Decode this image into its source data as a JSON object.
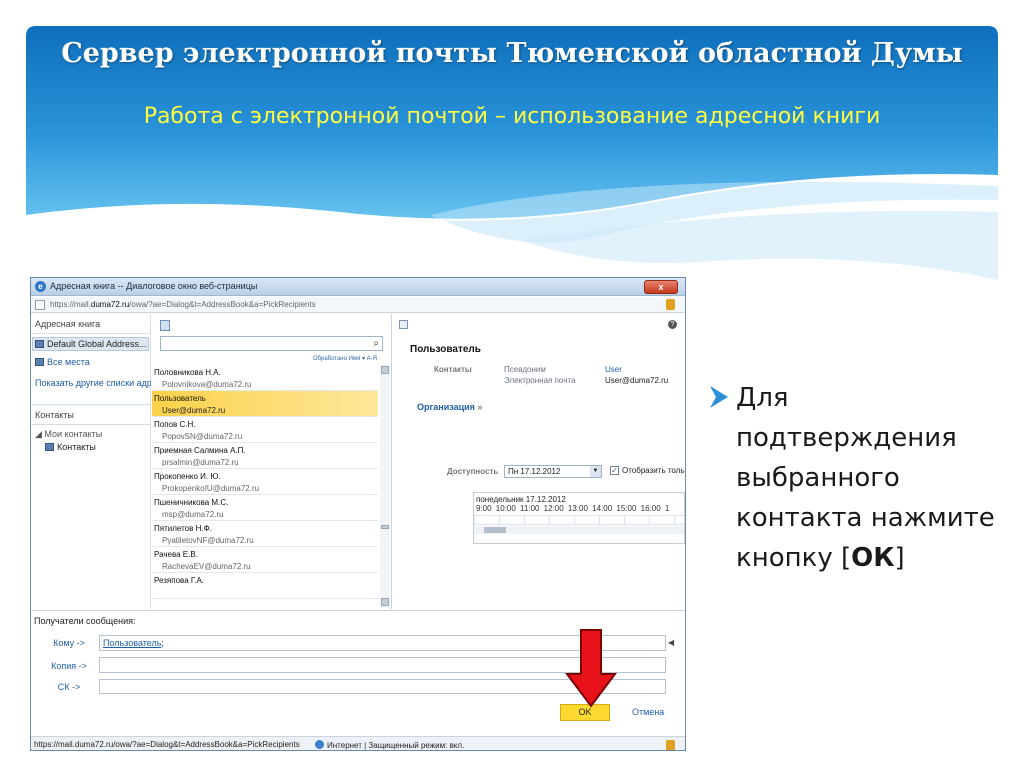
{
  "slide": {
    "title": "Сервер электронной почты Тюменской областной Думы",
    "subtitle": "Работа с электронной почтой – использование адресной книги",
    "bullet_before": "Для подтверждения выбранного контакта нажмите кнопку [",
    "bullet_bold": "ОК",
    "bullet_after": "]"
  },
  "window": {
    "title": "Адресная книга -- Диалоговое окно веб-страницы",
    "close_label": "x",
    "url_host": "https://mail.",
    "url_domain": "duma72.ru",
    "url_path": "/owa/?ae=Dialog&t=AddressBook&a=PickRecipients"
  },
  "leftnav": {
    "address_book_header": "Адресная книга",
    "selected_book": "Default Global Address...",
    "all_places": "Все места",
    "show_other_lists": "Показать другие списки адре",
    "contacts_header": "Контакты",
    "my_contacts": "Мои контакты",
    "contacts_folder": "Контакты"
  },
  "list": {
    "sort_label": "Обработано Имя ▾   А-Я",
    "entries": [
      {
        "name": "Половникова Н.А.",
        "email": "Polovnikova@duma72.ru"
      },
      {
        "name": "Пользователь",
        "email": "User@duma72.ru"
      },
      {
        "name": "Попов С.Н.",
        "email": "PopovSN@duma72.ru"
      },
      {
        "name": "Приемная Салмина А.П.",
        "email": "prsalmin@duma72.ru"
      },
      {
        "name": "Прокопенко И. Ю.",
        "email": "ProkopenkoIU@duma72.ru"
      },
      {
        "name": "Пшеничникова М.С.",
        "email": "msp@duma72.ru"
      },
      {
        "name": "Пятилетов Н.Ф.",
        "email": "PyatiletovNF@duma72.ru"
      },
      {
        "name": "Рачева Е.В.",
        "email": "RachevaEV@duma72.ru"
      },
      {
        "name": "Резяпова Г.А.",
        "email": ""
      }
    ],
    "selected_index": 1
  },
  "detail": {
    "title": "Пользователь",
    "contacts_label": "Контакты",
    "alias_label": "Псевдоним",
    "alias_value": "User",
    "email_label": "Электронная почта",
    "email_value": "User@duma72.ru",
    "organization_label": "Организация",
    "organization_chevron": "»",
    "availability_label": "Доступность",
    "date_value": "Пн 17.12.2012",
    "show_only_label": "Отобразить только ра",
    "schedule_day": "понедельник 17.12.2012",
    "schedule_hours": "9:00 10:00 11:00 12:00 13:00 14:00 15:00 16:00 1"
  },
  "recipients": {
    "header": "Получатели сообщения:",
    "to_label": "Кому ->",
    "to_value": "Пользователь",
    "to_separator": ";",
    "cc_label": "Копия ->",
    "bcc_label": "СК ->"
  },
  "buttons": {
    "ok": "OK",
    "cancel": "Отмена"
  },
  "status": {
    "url": "https://mail.duma72.ru/owa/?ae=Dialog&t=AddressBook&a=PickRecipients",
    "zone": "Интернет | Защищенный режим: вкл."
  },
  "colors": {
    "banner_top": "#0e6fbc",
    "banner_bottom": "#5ab9ec",
    "subtitle": "#ffff40",
    "selection": "#fbd24a",
    "ok_button": "#fdd930",
    "annotation_arrow": "#e8131a"
  }
}
